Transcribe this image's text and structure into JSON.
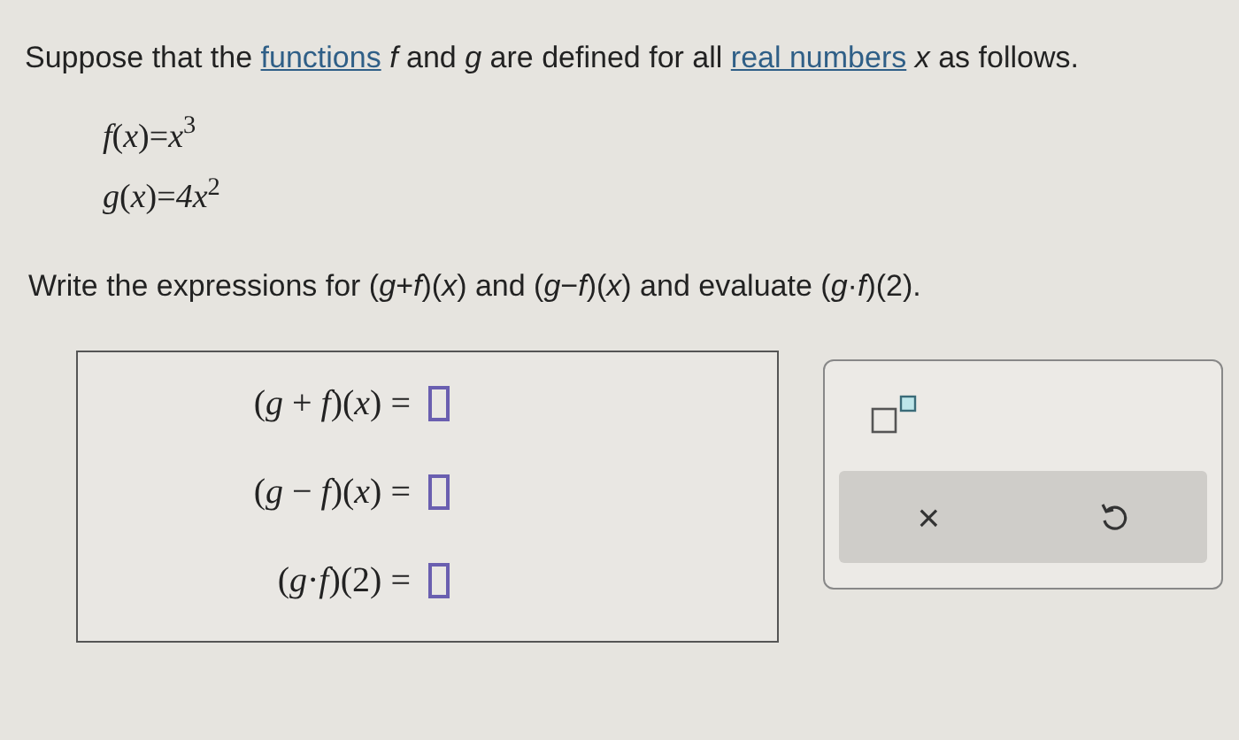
{
  "intro": {
    "before": "Suppose that the",
    "link1": "functions",
    "middle": "*f* and *g* are defined for all",
    "link2": "real numbers",
    "after": "*x* as follows."
  },
  "equations": [
    "*f*(*x*)=*x*$^{3}$",
    "*g*(*x*)=*4x*$^{2}$"
  ],
  "instruction": "Write the expressions for (*g*+*f*)(*x*) and (*g*−*f*)(*x*) and evaluate (*g*·*f*)(2).",
  "answers": [
    {
      "label": "(*g* + *f*)(*x*) ="
    },
    {
      "label": "(*g* − *f*)(*x*) ="
    },
    {
      "label": "(*g*·*f*)(2) ="
    }
  ],
  "toolbar": {
    "clear": "×"
  }
}
